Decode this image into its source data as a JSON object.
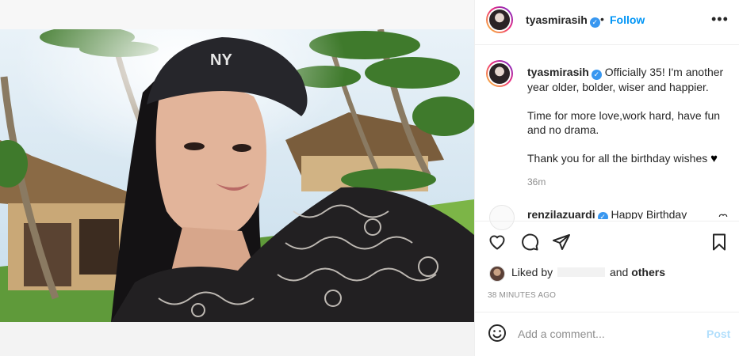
{
  "post": {
    "username": "tyasmirasih",
    "verified": true,
    "follow_label": "Follow",
    "separator": "•",
    "more_label": "•••",
    "caption": {
      "line1": "Officially 35! I'm another year older, bolder, wiser and happier.",
      "line2": "Time for more love,work hard, have fun and no drama.",
      "line3": "Thank you for all the birthday wishes"
    },
    "time_ago": "36m"
  },
  "comment": {
    "username": "renzilazuardi",
    "verified": true,
    "text": "Happy Birthday"
  },
  "likes": {
    "prefix": "Liked by",
    "connector": "and",
    "others": "others"
  },
  "timestamp": "38 MINUTES AGO",
  "add_comment": {
    "placeholder": "Add a comment...",
    "post_label": "Post"
  },
  "icons": {
    "like": "heart-icon",
    "comment": "comment-icon",
    "share": "share-icon",
    "save": "bookmark-icon",
    "emoji": "emoji-icon",
    "more": "more-icon"
  },
  "colors": {
    "accent": "#0095f6",
    "post_disabled": "#b2dffc",
    "verified": "#3897f0",
    "muted": "#8e8e8e"
  }
}
